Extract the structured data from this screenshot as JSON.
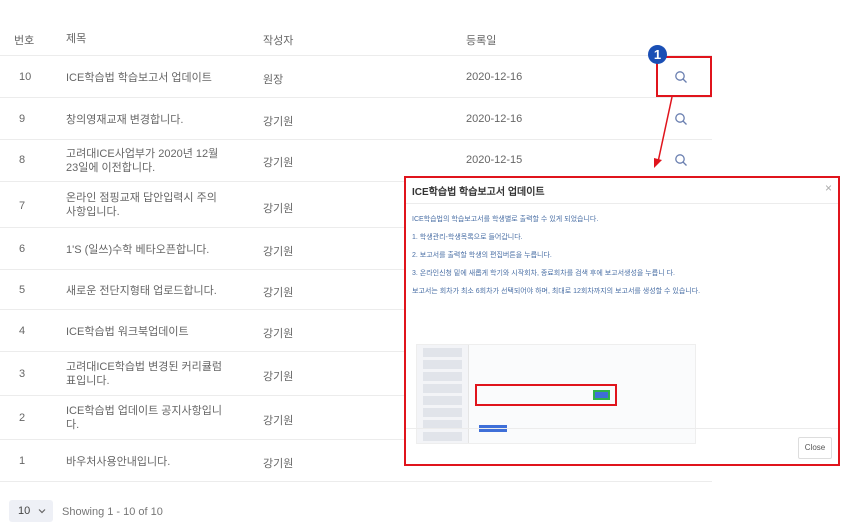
{
  "table": {
    "headers": {
      "no": "번호",
      "title": "제목",
      "author": "작성자",
      "date": "등록일"
    },
    "rows": [
      {
        "no": "10",
        "title": "ICE학습법 학습보고서 업데이트",
        "author": "원장",
        "date": "2020-12-16"
      },
      {
        "no": "9",
        "title": "창의영재교재 변경합니다.",
        "author": "강기원",
        "date": "2020-12-16"
      },
      {
        "no": "8",
        "title": "고려대ICE사업부가 2020년 12월 23일에 이전합니다.",
        "author": "강기원",
        "date": "2020-12-15"
      },
      {
        "no": "7",
        "title": "온라인 점핑교재 답안입력시 주의사항입니다.",
        "author": "강기원",
        "date": ""
      },
      {
        "no": "6",
        "title": "1'S (일쓰)수학 베타오픈합니다.",
        "author": "강기원",
        "date": ""
      },
      {
        "no": "5",
        "title": "새로운 전단지형태 업로드합니다.",
        "author": "강기원",
        "date": ""
      },
      {
        "no": "4",
        "title": "ICE학습법 워크북업데이트",
        "author": "강기원",
        "date": ""
      },
      {
        "no": "3",
        "title": "고려대ICE학습법 변경된 커리큘럼 표입니다.",
        "author": "강기원",
        "date": ""
      },
      {
        "no": "2",
        "title": "ICE학습법 업데이트 공지사항입니다.",
        "author": "강기원",
        "date": ""
      },
      {
        "no": "1",
        "title": "바우처사용안내입니다.",
        "author": "강기원",
        "date": ""
      }
    ]
  },
  "badge": "1",
  "modal": {
    "title": "ICE학습법 학습보고서 업데이트",
    "lines": [
      "ICE학습법의 학습보고서를 학생별로 출력할 수 있게 되었습니다.",
      "1. 학생관리-학생목록으로 들어갑니다.",
      "2. 보고서를 출력할 학생의 편집버튼을 누릅니다.",
      "3. 온라인신청 밑에 새롭게 학기와 시작회차, 종료회차를 검색 후에 보고서생성을 누릅니      다.",
      "보고서는 회차가 최소 6회차가 선택되어야 하며, 최대로 12회차까지의 보고서를 생성할 수 있습니다."
    ],
    "close_label": "Close"
  },
  "footer": {
    "per_page": "10",
    "showing": "Showing 1 - 10 of 10"
  },
  "colors": {
    "highlight": "#e0141c",
    "badge": "#1a4fb5",
    "link_text": "#4a6fa5"
  }
}
